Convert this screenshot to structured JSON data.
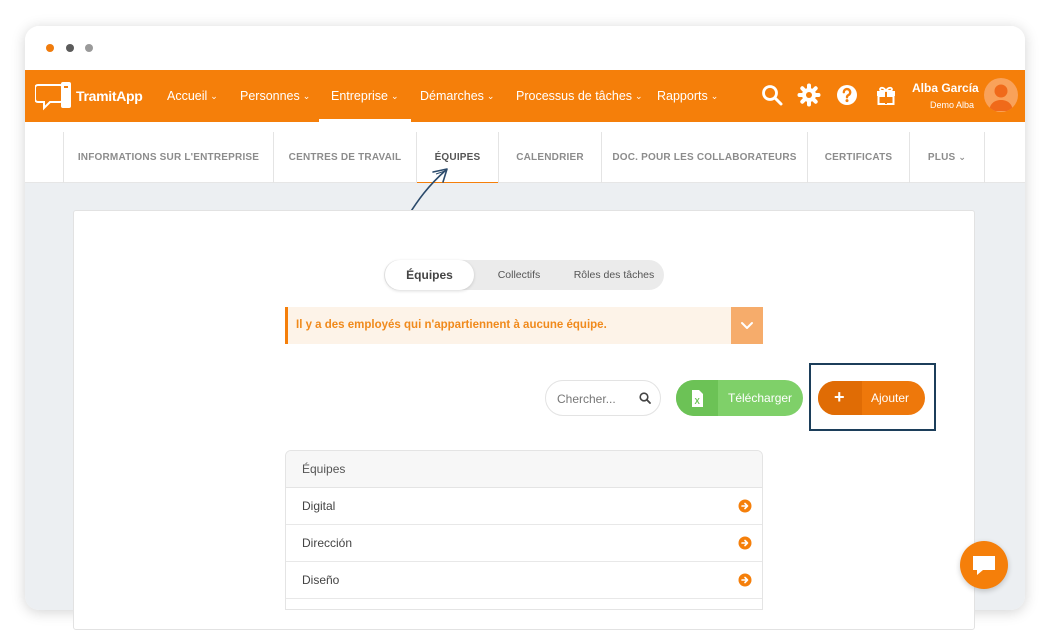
{
  "brand": {
    "name": "TramitApp",
    "accent": "#f57f0a"
  },
  "nav": {
    "items": [
      {
        "label": "Accueil",
        "chevron": "chevron-down-icon"
      },
      {
        "label": "Personnes",
        "chevron": "chevron-down-icon"
      },
      {
        "label": "Entreprise",
        "chevron": "chevron-down-icon"
      },
      {
        "label": "Démarches",
        "chevron": "chevron-down-icon"
      },
      {
        "label": "Processus de tâches",
        "chevron": "chevron-down-icon"
      },
      {
        "label": "Rapports",
        "chevron": "chevron-down-icon"
      }
    ],
    "icons": [
      "search-icon",
      "gear-icon",
      "help-icon",
      "gift-icon"
    ]
  },
  "user": {
    "name": "Alba García",
    "company": "Demo Alba"
  },
  "tabs": [
    "INFORMATIONS SUR L'ENTREPRISE",
    "CENTRES DE TRAVAIL",
    "ÉQUIPES",
    "CALENDRIER",
    "DOC. POUR LES COLLABORATEURS",
    "CERTIFICATS",
    "PLUS"
  ],
  "segments": [
    "Équipes",
    "Collectifs",
    "Rôles des tâches"
  ],
  "alert": {
    "text": "Il y a des employés qui n'appartiennent à aucune équipe."
  },
  "search": {
    "placeholder": "Chercher..."
  },
  "buttons": {
    "download": "Télécharger",
    "add": "Ajouter"
  },
  "table": {
    "header": "Équipes",
    "rows": [
      "Digital",
      "Dirección",
      "Diseño"
    ]
  }
}
